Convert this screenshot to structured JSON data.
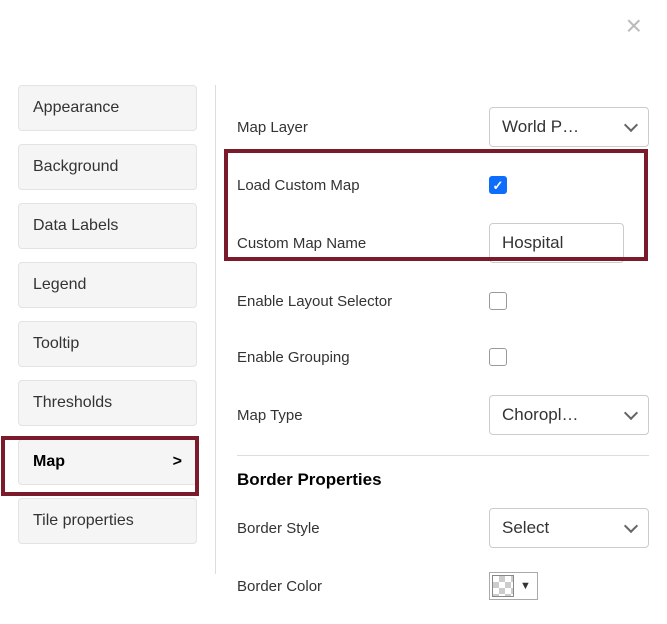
{
  "close_label": "×",
  "sidebar": {
    "items": [
      {
        "label": "Appearance"
      },
      {
        "label": "Background"
      },
      {
        "label": "Data Labels"
      },
      {
        "label": "Legend"
      },
      {
        "label": "Tooltip"
      },
      {
        "label": "Thresholds"
      },
      {
        "label": "Map",
        "active": true,
        "caret": ">"
      },
      {
        "label": "Tile properties"
      }
    ]
  },
  "main": {
    "map_layer": {
      "label": "Map Layer",
      "value": "World P…"
    },
    "load_custom": {
      "label": "Load Custom Map",
      "checked": true
    },
    "custom_name": {
      "label": "Custom Map Name",
      "value": "Hospital"
    },
    "enable_layout": {
      "label": "Enable Layout Selector",
      "checked": false
    },
    "enable_grouping": {
      "label": "Enable Grouping",
      "checked": false
    },
    "map_type": {
      "label": "Map Type",
      "value": "Choropl…"
    },
    "border_section": "Border Properties",
    "border_style": {
      "label": "Border Style",
      "value": "Select"
    },
    "border_color": {
      "label": "Border Color"
    }
  }
}
